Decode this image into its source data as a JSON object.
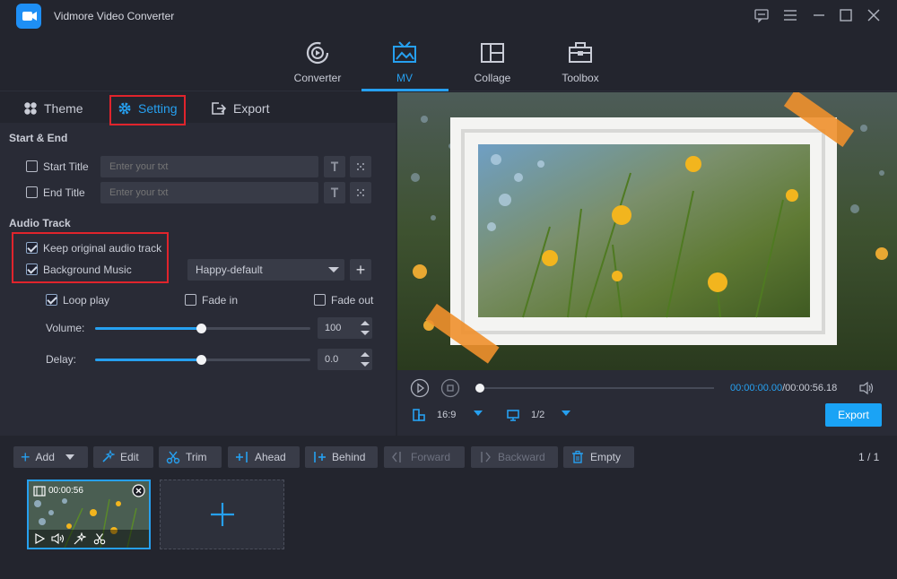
{
  "app": {
    "title": "Vidmore Video Converter"
  },
  "nav": {
    "items": [
      {
        "label": "Converter"
      },
      {
        "label": "MV"
      },
      {
        "label": "Collage"
      },
      {
        "label": "Toolbox"
      }
    ]
  },
  "subtabs": {
    "theme": "Theme",
    "setting": "Setting",
    "export": "Export"
  },
  "start_end": {
    "heading": "Start & End",
    "start_title_label": "Start Title",
    "end_title_label": "End Title",
    "placeholder": "Enter your txt"
  },
  "audio": {
    "heading": "Audio Track",
    "keep_original": "Keep original audio track",
    "background_music": "Background Music",
    "music_selected": "Happy-default",
    "loop_play": "Loop play",
    "fade_in": "Fade in",
    "fade_out": "Fade out",
    "volume_label": "Volume:",
    "volume_value": "100",
    "volume_level": 1.0,
    "delay_label": "Delay:",
    "delay_value": "0.0",
    "keep_original_checked": true,
    "background_music_checked": true,
    "loop_play_checked": true,
    "fade_in_checked": false,
    "fade_out_checked": false
  },
  "player": {
    "time_current": "00:00:00.00",
    "time_total": "/00:00:56.18",
    "aspect_ratio": "16:9",
    "page": "1/2",
    "export_label": "Export"
  },
  "toolbar": {
    "add": "Add",
    "edit": "Edit",
    "trim": "Trim",
    "ahead": "Ahead",
    "behind": "Behind",
    "forward": "Forward",
    "backward": "Backward",
    "empty": "Empty",
    "page_count": "1 / 1"
  },
  "clip": {
    "duration": "00:00:56"
  },
  "colors": {
    "accent": "#26a0f0",
    "highlight": "#e0242c",
    "background": "#23252e"
  }
}
